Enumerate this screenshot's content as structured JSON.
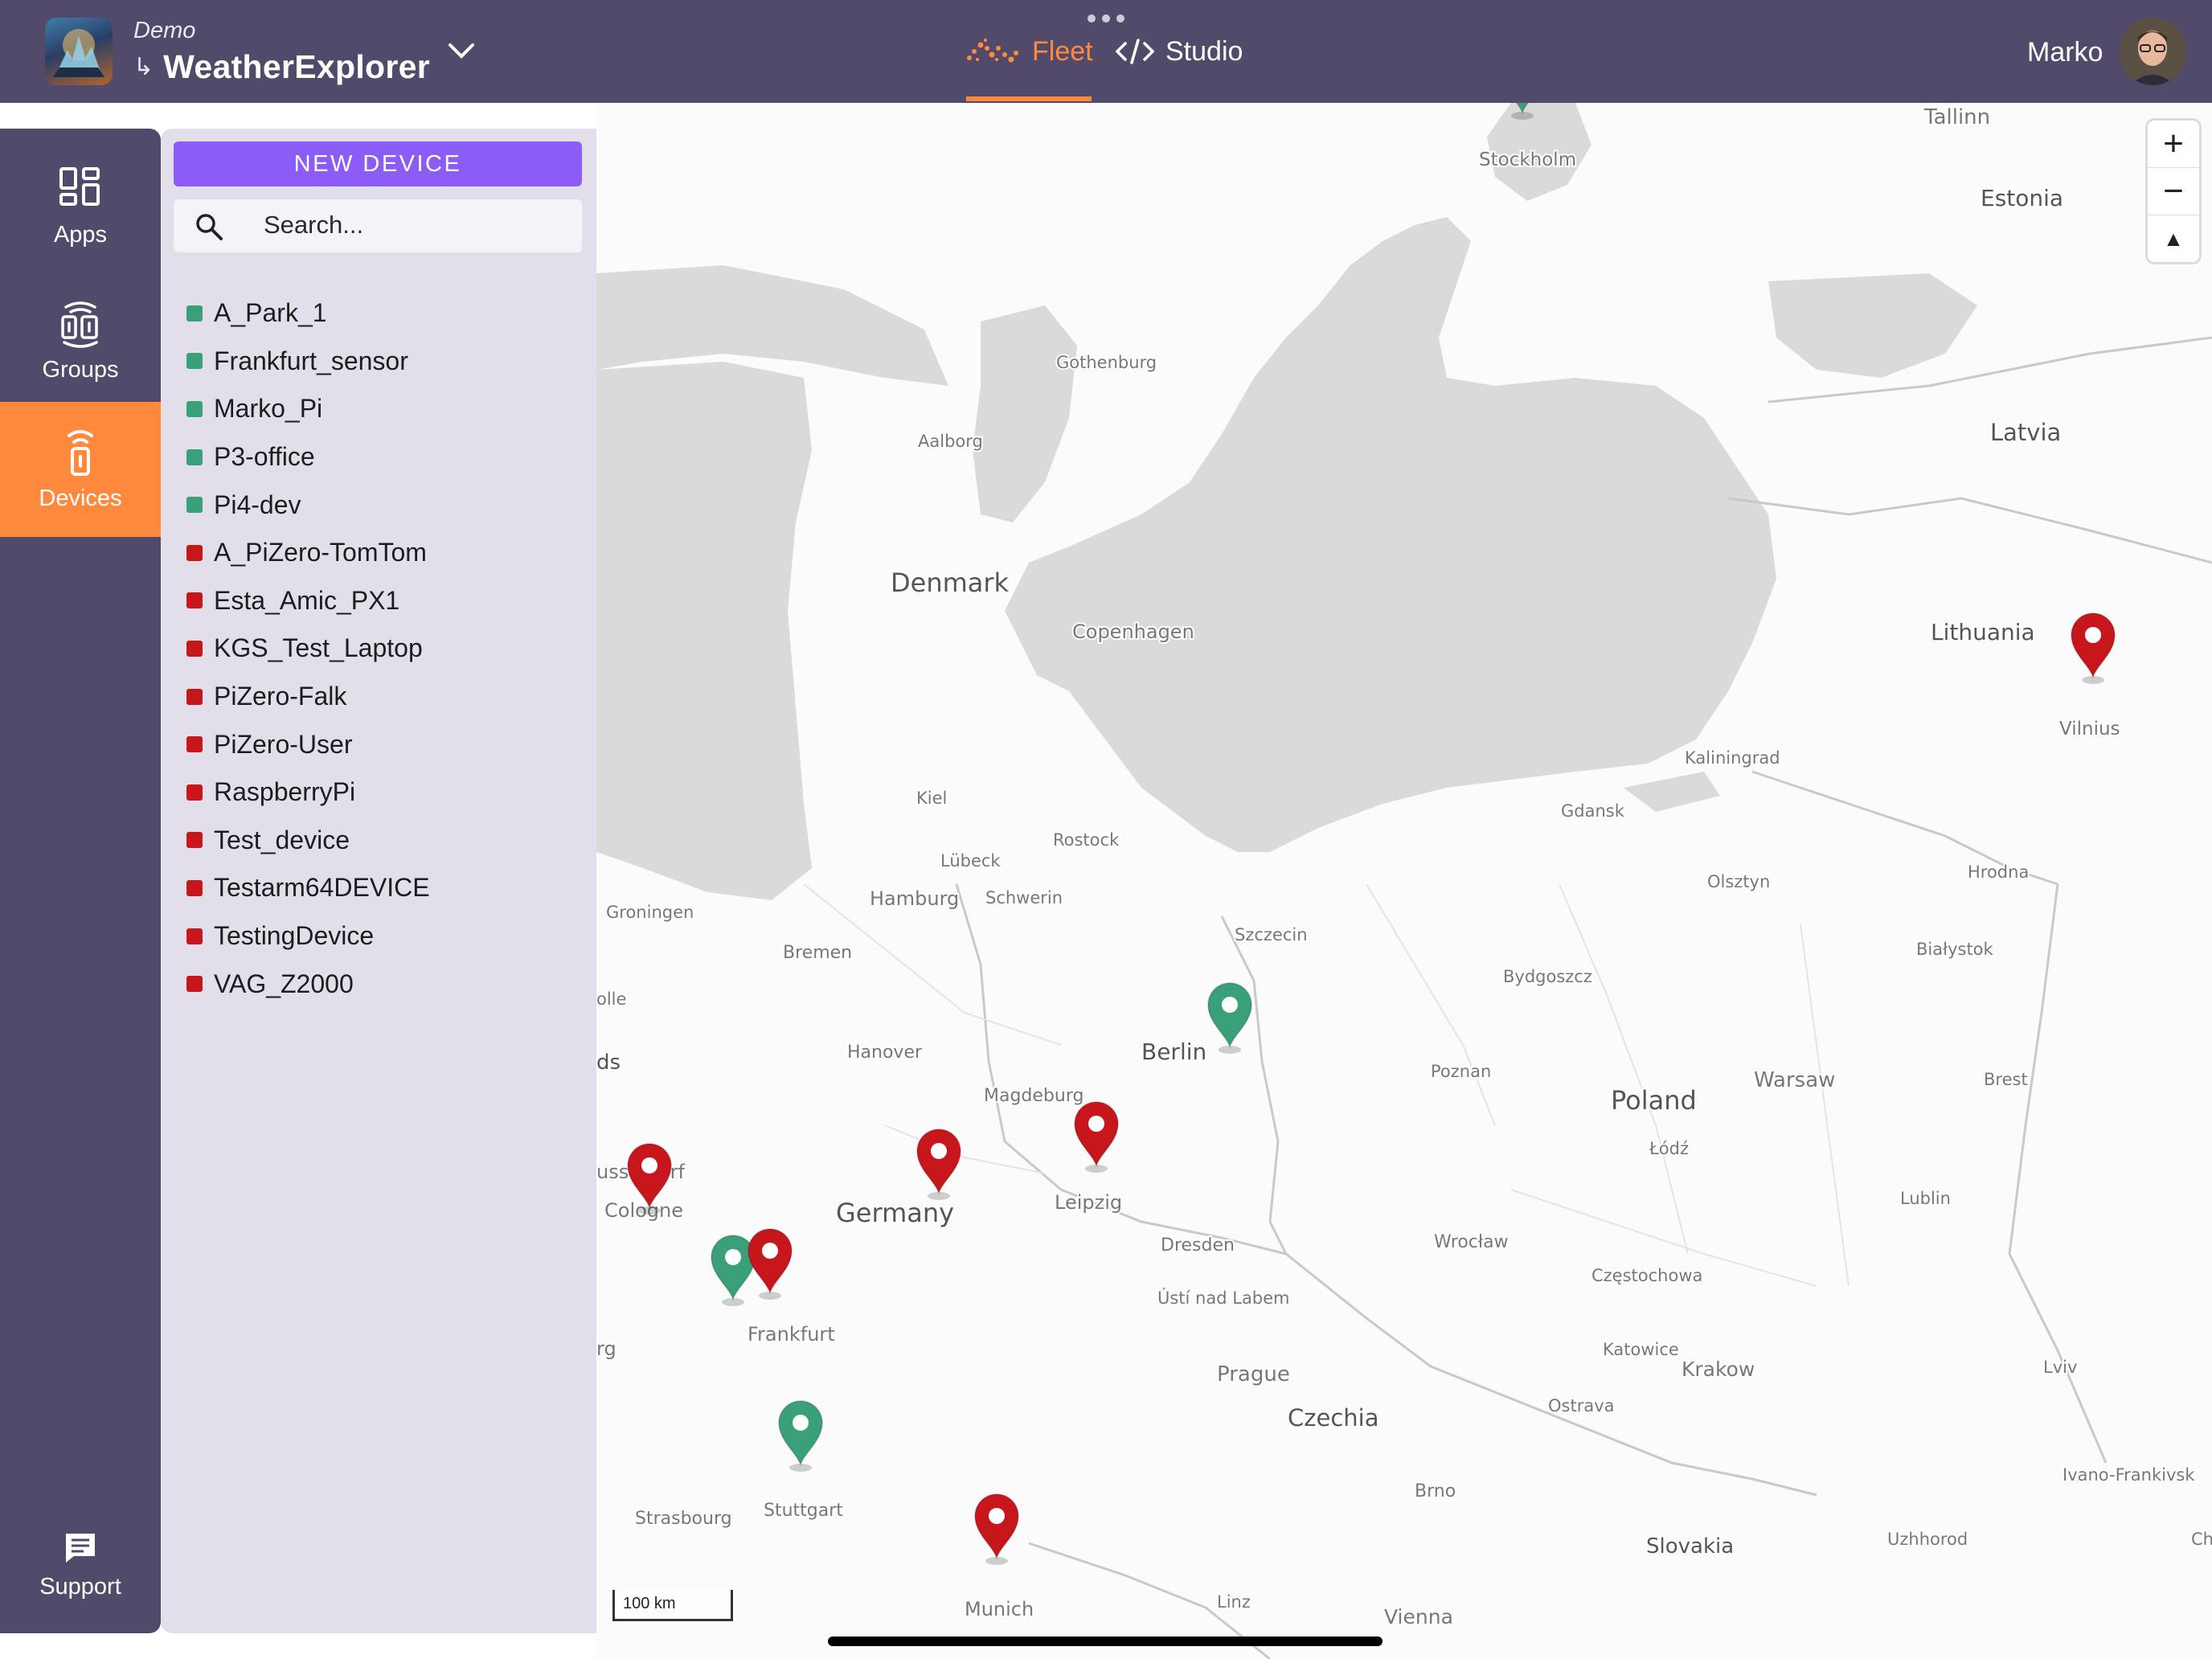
{
  "header": {
    "org": "Demo",
    "sub_arrow": "↳",
    "app_name": "WeatherExplorer",
    "tabs": [
      {
        "label": "Fleet",
        "active": true
      },
      {
        "label": "Studio",
        "active": false
      }
    ],
    "user": "Marko",
    "accent_color": "#ff8a3d",
    "bar_color": "#524a6b"
  },
  "rail": {
    "items": [
      {
        "label": "Apps",
        "icon": "apps-grid-icon"
      },
      {
        "label": "Groups",
        "icon": "groups-icon"
      },
      {
        "label": "Devices",
        "icon": "device-icon",
        "active": true
      }
    ],
    "support": {
      "label": "Support",
      "icon": "chat-icon"
    }
  },
  "panel": {
    "new_device_label": "NEW DEVICE",
    "search_placeholder": "Search...",
    "devices": [
      {
        "name": "A_Park_1",
        "status": "online"
      },
      {
        "name": "Frankfurt_sensor",
        "status": "online"
      },
      {
        "name": "Marko_Pi",
        "status": "online"
      },
      {
        "name": "P3-office",
        "status": "online"
      },
      {
        "name": "Pi4-dev",
        "status": "online"
      },
      {
        "name": "A_PiZero-TomTom",
        "status": "offline"
      },
      {
        "name": "Esta_Amic_PX1",
        "status": "offline"
      },
      {
        "name": "KGS_Test_Laptop",
        "status": "offline"
      },
      {
        "name": "PiZero-Falk",
        "status": "offline"
      },
      {
        "name": "PiZero-User",
        "status": "offline"
      },
      {
        "name": "RaspberryPi",
        "status": "offline"
      },
      {
        "name": "Test_device",
        "status": "offline"
      },
      {
        "name": "Testarm64DEVICE",
        "status": "offline"
      },
      {
        "name": "TestingDevice",
        "status": "offline"
      },
      {
        "name": "VAG_Z2000",
        "status": "offline"
      }
    ],
    "status_colors": {
      "online": "#3aa07a",
      "offline": "#c8161d"
    }
  },
  "map": {
    "labels": {
      "tallinn": "Tallinn",
      "estonia": "Estonia",
      "stockholm": "Stockholm",
      "gothenburg": "Gothenburg",
      "aalborg": "Aalborg",
      "latvia": "Latvia",
      "denmark": "Denmark",
      "copenhagen": "Copenhagen",
      "lithuania": "Lithuania",
      "vilnius": "Vilnius",
      "kaliningrad": "Kaliningrad",
      "kiel": "Kiel",
      "gdansk": "Gdansk",
      "rostock": "Rostock",
      "lubeck": "Lübeck",
      "olsztyn": "Olsztyn",
      "hrodna": "Hrodna",
      "hamburg": "Hamburg",
      "schwerin": "Schwerin",
      "groningen": "Groningen",
      "szczecin": "Szczecin",
      "bremen": "Bremen",
      "bialystok": "Białystok",
      "bydgoszcz": "Bydgoszcz",
      "zwolle": "olle",
      "nl": "ds",
      "hanover": "Hanover",
      "berlin": "Berlin",
      "poznan": "Poznan",
      "warsaw": "Warsaw",
      "brest": "Brest",
      "magdeburg": "Magdeburg",
      "poland": "Poland",
      "lodz": "Łódź",
      "dusseldorf": "usseldorf",
      "cologne": "Cologne",
      "germany": "Germany",
      "leipzig": "Leipzig",
      "lublin": "Lublin",
      "dresden": "Dresden",
      "wroclaw": "Wrocław",
      "czestochowa": "Częstochowa",
      "usti": "Ústí nad Labem",
      "frankfurt": "Frankfurt",
      "luxembourg": "rg",
      "katowice": "Katowice",
      "krakow": "Krakow",
      "lviv": "Lviv",
      "prague": "Prague",
      "ostrava": "Ostrava",
      "czechia": "Czechia",
      "ivano": "Ivano-Frankivsk",
      "brno": "Brno",
      "strasbourg": "Strasbourg",
      "stuttgart": "Stuttgart",
      "slovakia": "Slovakia",
      "uzhhorod": "Uzhhorod",
      "ch": "Ch",
      "munich": "Munich",
      "linz": "Linz",
      "vienna": "Vienna"
    },
    "markers": [
      {
        "city": "Stockholm",
        "status": "online"
      },
      {
        "city": "Vilnius",
        "status": "offline"
      },
      {
        "city": "Berlin",
        "status": "online"
      },
      {
        "city": "Leipzig",
        "status": "offline"
      },
      {
        "city": "Germany",
        "status": "offline"
      },
      {
        "city": "Cologne",
        "status": "offline"
      },
      {
        "city": "Frankfurt",
        "status": "online"
      },
      {
        "city": "Frankfurt",
        "status": "offline"
      },
      {
        "city": "Stuttgart",
        "status": "online"
      },
      {
        "city": "Munich",
        "status": "offline"
      }
    ],
    "zoom_in": "+",
    "zoom_out": "−",
    "compass": "▲",
    "scale_label": "100 km",
    "land_color": "#fbfbfb",
    "water_color": "#dadada"
  }
}
